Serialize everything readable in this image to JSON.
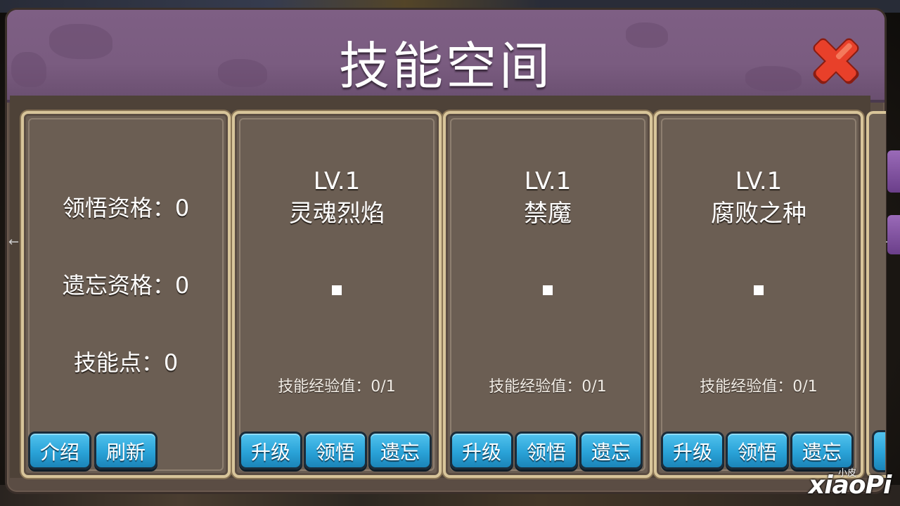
{
  "title": "技能空间",
  "stats": {
    "comprehend_qualification": "领悟资格：0",
    "forget_qualification": "遗忘资格：0",
    "skill_points": "技能点：0"
  },
  "info_buttons": {
    "intro": "介绍",
    "refresh": "刷新"
  },
  "skills": [
    {
      "level": "LV.1",
      "name": "灵魂烈焰",
      "exp": "技能经验值：0/1"
    },
    {
      "level": "LV.1",
      "name": "禁魔",
      "exp": "技能经验值：0/1"
    },
    {
      "level": "LV.1",
      "name": "腐败之种",
      "exp": "技能经验值：0/1"
    }
  ],
  "skill_buttons": {
    "upgrade": "升级",
    "comprehend": "领悟",
    "forget": "遗忘"
  },
  "watermark": {
    "small": "小皮",
    "main": "xiaoPi"
  },
  "colors": {
    "title_bar": "#7e5f84",
    "panel": "#5b4d44",
    "card": "#6b5e53",
    "card_border": "#d8c59a",
    "button": "#2aa3d8",
    "close": "#e8402a"
  },
  "icons": {
    "close": "close-x-icon",
    "left_nav": "arrow-left-icon",
    "right_nav": "arrow-right-icon"
  }
}
